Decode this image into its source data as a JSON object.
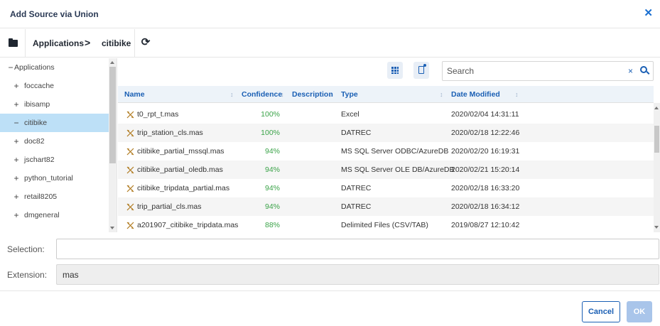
{
  "dialog": {
    "title": "Add Source via Union",
    "close_icon": "close-icon"
  },
  "breadcrumb": {
    "items": [
      "Applications",
      "citibike"
    ],
    "separator": ">"
  },
  "tree": {
    "root": {
      "label": "Applications",
      "sign": "−"
    },
    "items": [
      {
        "label": "foccache",
        "sign": "+"
      },
      {
        "label": "ibisamp",
        "sign": "+"
      },
      {
        "label": "citibike",
        "sign": "−",
        "selected": true
      },
      {
        "label": "doc82",
        "sign": "+"
      },
      {
        "label": "jschart82",
        "sign": "+"
      },
      {
        "label": "python_tutorial",
        "sign": "+"
      },
      {
        "label": "retail8205",
        "sign": "+"
      },
      {
        "label": "dmgeneral",
        "sign": "+"
      }
    ]
  },
  "search": {
    "placeholder": "Search",
    "clear": "×"
  },
  "table": {
    "columns": [
      "Name",
      "Confidence",
      "Description",
      "Type",
      "Date Modified"
    ],
    "rows": [
      {
        "name": "t0_rpt_t.mas",
        "confidence": "100%",
        "description": "",
        "type": "Excel",
        "date": "2020/02/04 14:31:11"
      },
      {
        "name": "trip_station_cls.mas",
        "confidence": "100%",
        "description": "",
        "type": "DATREC",
        "date": "2020/02/18 12:22:46"
      },
      {
        "name": "citibike_partial_mssql.mas",
        "confidence": "94%",
        "description": "",
        "type": "MS SQL Server ODBC/AzureDB",
        "date": "2020/02/20 16:19:31"
      },
      {
        "name": "citibike_partial_oledb.mas",
        "confidence": "94%",
        "description": "",
        "type": "MS SQL Server OLE DB/AzureDB",
        "date": "2020/02/21 15:20:14"
      },
      {
        "name": "citibike_tripdata_partial.mas",
        "confidence": "94%",
        "description": "",
        "type": "DATREC",
        "date": "2020/02/18 16:33:20"
      },
      {
        "name": "trip_partial_cls.mas",
        "confidence": "94%",
        "description": "",
        "type": "DATREC",
        "date": "2020/02/18 16:34:12"
      },
      {
        "name": "a201907_citibike_tripdata.mas",
        "confidence": "88%",
        "description": "",
        "type": "Delimited Files (CSV/TAB)",
        "date": "2019/08/27 12:10:42"
      }
    ]
  },
  "form": {
    "selection_label": "Selection:",
    "selection_value": "",
    "extension_label": "Extension:",
    "extension_value": "mas"
  },
  "buttons": {
    "cancel": "Cancel",
    "ok": "OK"
  },
  "colors": {
    "accent": "#1a5fb4",
    "confidence": "#3aa348",
    "selected_row": "#bde0f7"
  }
}
